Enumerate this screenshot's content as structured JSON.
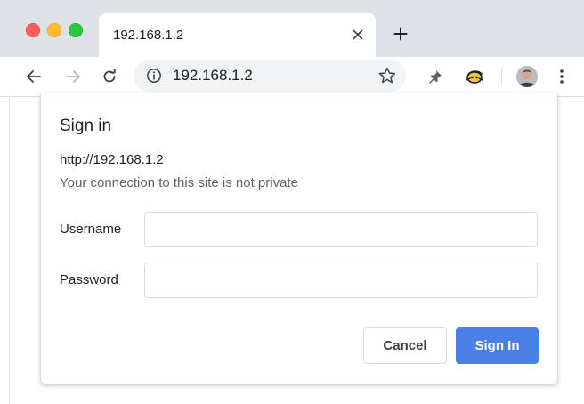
{
  "tab": {
    "title": "192.168.1.2",
    "close_icon": "close-icon"
  },
  "toolbar": {
    "url": "192.168.1.2",
    "back_icon": "back-arrow-icon",
    "forward_icon": "forward-arrow-icon",
    "reload_icon": "reload-icon",
    "info_icon": "info-icon",
    "bookmark_icon": "star-icon",
    "extension_1_icon": "pin-icon",
    "extension_2_icon": "extension-icon",
    "menu_icon": "more-vertical-icon"
  },
  "dialog": {
    "title": "Sign in",
    "url": "http://192.168.1.2",
    "warning": "Your connection to this site is not private",
    "username_label": "Username",
    "username_value": "",
    "password_label": "Password",
    "password_value": "",
    "cancel_label": "Cancel",
    "signin_label": "Sign In"
  },
  "colors": {
    "tabstrip_bg": "#dee1e6",
    "primary_button": "#4a80e6",
    "traffic_red": "#ff5f57",
    "traffic_yellow": "#febc2e",
    "traffic_green": "#28c840"
  }
}
